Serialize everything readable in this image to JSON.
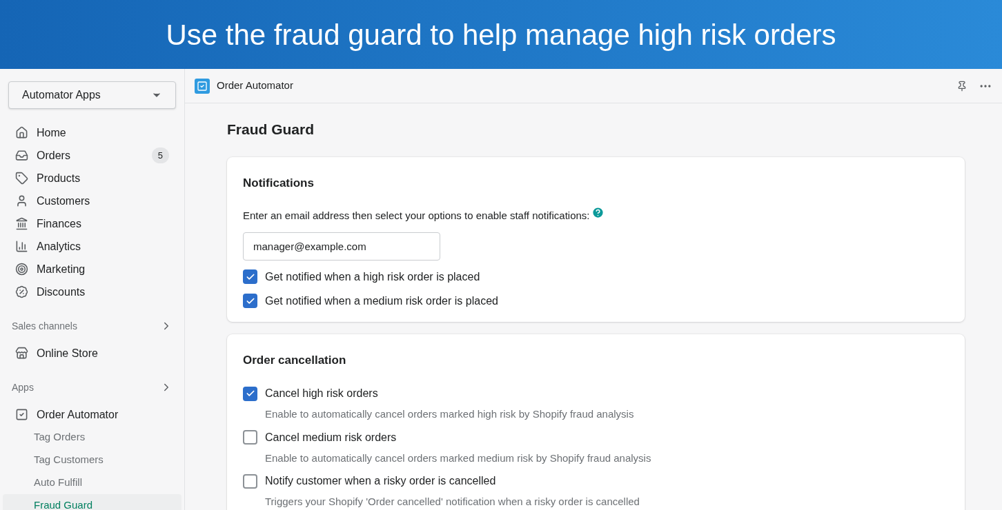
{
  "banner": {
    "title": "Use the fraud guard to help manage high risk orders"
  },
  "sidebar": {
    "store_selector": "Automator Apps",
    "items": [
      {
        "label": "Home",
        "kind": "home"
      },
      {
        "label": "Orders",
        "kind": "orders",
        "badge": "5"
      },
      {
        "label": "Products",
        "kind": "tag"
      },
      {
        "label": "Customers",
        "kind": "user"
      },
      {
        "label": "Finances",
        "kind": "bank"
      },
      {
        "label": "Analytics",
        "kind": "chart"
      },
      {
        "label": "Marketing",
        "kind": "target"
      },
      {
        "label": "Discounts",
        "kind": "discount"
      }
    ],
    "sections": [
      {
        "title": "Sales channels",
        "items": [
          {
            "label": "Online Store",
            "kind": "store"
          }
        ]
      },
      {
        "title": "Apps",
        "items": [
          {
            "label": "Order Automator",
            "kind": "app",
            "children": [
              {
                "label": "Tag Orders",
                "selected": false
              },
              {
                "label": "Tag Customers",
                "selected": false
              },
              {
                "label": "Auto Fulfill",
                "selected": false
              },
              {
                "label": "Fraud Guard",
                "selected": true
              }
            ]
          }
        ]
      }
    ]
  },
  "topbar": {
    "app_name": "Order Automator"
  },
  "page": {
    "title": "Fraud Guard",
    "cards": [
      {
        "title": "Notifications",
        "instruction": "Enter an email address then select your options to enable staff notifications:",
        "email": "manager@example.com",
        "options": [
          {
            "label": "Get notified when a high risk order is placed",
            "checked": true
          },
          {
            "label": "Get notified when a medium risk order is placed",
            "checked": true
          }
        ]
      },
      {
        "title": "Order cancellation",
        "options": [
          {
            "label": "Cancel high risk orders",
            "checked": true,
            "help": "Enable to automatically cancel orders marked high risk by Shopify fraud analysis"
          },
          {
            "label": "Cancel medium risk orders",
            "checked": false,
            "help": "Enable to automatically cancel orders marked medium risk by Shopify fraud analysis"
          },
          {
            "label": "Notify customer when a risky order is cancelled",
            "checked": false,
            "help": "Triggers your Shopify 'Order cancelled' notification when a risky order is cancelled"
          }
        ]
      }
    ]
  }
}
